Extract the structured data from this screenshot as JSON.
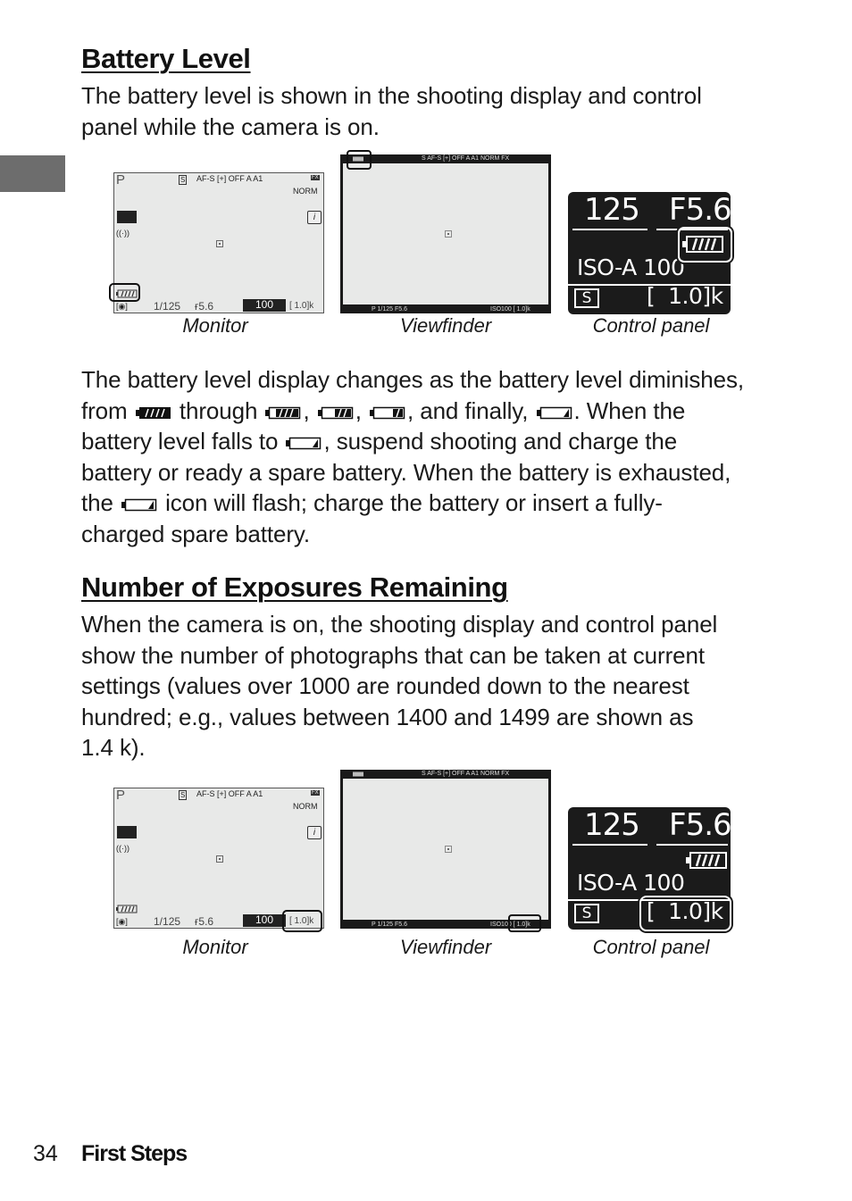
{
  "section1": {
    "heading": "Battery Level",
    "intro_line1": "The battery level is shown in the shooting display and control",
    "intro_line2": "panel while the camera is on.",
    "para": {
      "l1": "The battery level display changes as the battery level diminishes,",
      "l2_from": "from",
      "l2_through": "through",
      "l2_comma1": ",",
      "l2_comma2": ",",
      "l2_andfinally": ", and finally,",
      "l2_end": ". When the",
      "l3_a": "battery level falls to",
      "l3_b": ", suspend shooting and charge the",
      "l4": "battery or ready a spare battery. When the battery is exhausted,",
      "l5_a": "the",
      "l5_b": "icon will flash; charge the battery or insert a fully-",
      "l6": "charged spare battery."
    },
    "battery_levels": [
      {
        "name": "full",
        "bars": 4
      },
      {
        "name": "three-quarter",
        "bars": 3
      },
      {
        "name": "half",
        "bars": 2
      },
      {
        "name": "quarter",
        "bars": 1
      },
      {
        "name": "low",
        "bars": 0.5
      },
      {
        "name": "exhausted",
        "bars": 0.5
      }
    ],
    "figure": {
      "captions": [
        "Monitor",
        "Viewfinder",
        "Control panel"
      ],
      "highlight": "battery"
    }
  },
  "section2": {
    "heading": "Number of Exposures Remaining",
    "lines": [
      "When the camera is on, the shooting display and control panel",
      "show the number of photographs that can be taken at current",
      "settings (values over 1000 are rounded down to the nearest",
      "hundred; e.g., values between 1400 and 1499 are shown as",
      "1.4 k)."
    ],
    "figure": {
      "captions": [
        "Monitor",
        "Viewfinder",
        "Control panel"
      ],
      "highlight": "exposures-remaining"
    }
  },
  "display": {
    "mode": "P",
    "release_mode": "S",
    "af_mode": "AF-S",
    "image_quality": "NORM",
    "shutter_prefix": "1/",
    "shutter": "125",
    "aperture_prefix": "F",
    "aperture": "5.6",
    "iso_label": "ISO AUTO",
    "iso": "100",
    "iso_cp": "ISO-A 100",
    "exposures_remaining": "[ 1.0]k",
    "exposures_cp": "[  1.0]k",
    "top_icons": "AF-S  [+]  OFF  A  A1",
    "vf_top": "S  AF-S [+] OFF  A  A1      NORM  FX",
    "vf_bottom_left": "P     1/125   F5.6",
    "vf_bottom_right": "ISO100   [ 1.0]k",
    "info_icon": "i",
    "fx_badge": "FX"
  },
  "footer": {
    "page_number": "34",
    "section": "First Steps"
  }
}
